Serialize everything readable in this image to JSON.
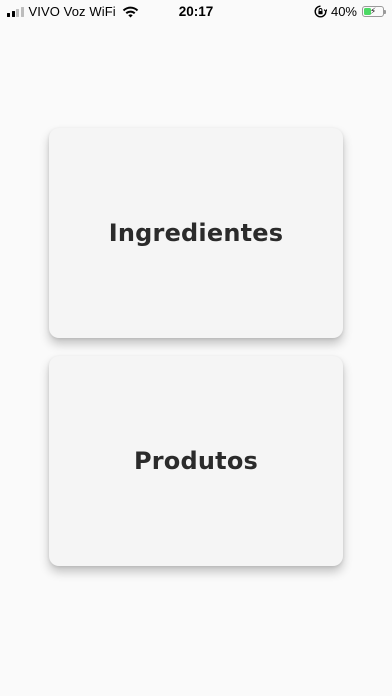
{
  "status_bar": {
    "carrier": "VIVO Voz WiFi",
    "time": "20:17",
    "battery_percent": "40%",
    "battery_level": 0.4,
    "signal_bars_active": 2,
    "signal_bars_total": 4,
    "wifi_icon": "wifi-icon",
    "rotation_lock_icon": "rotation-lock-icon",
    "battery_color": "#4cd964"
  },
  "menu": {
    "items": [
      {
        "label": "Ingredientes"
      },
      {
        "label": "Produtos"
      }
    ]
  }
}
